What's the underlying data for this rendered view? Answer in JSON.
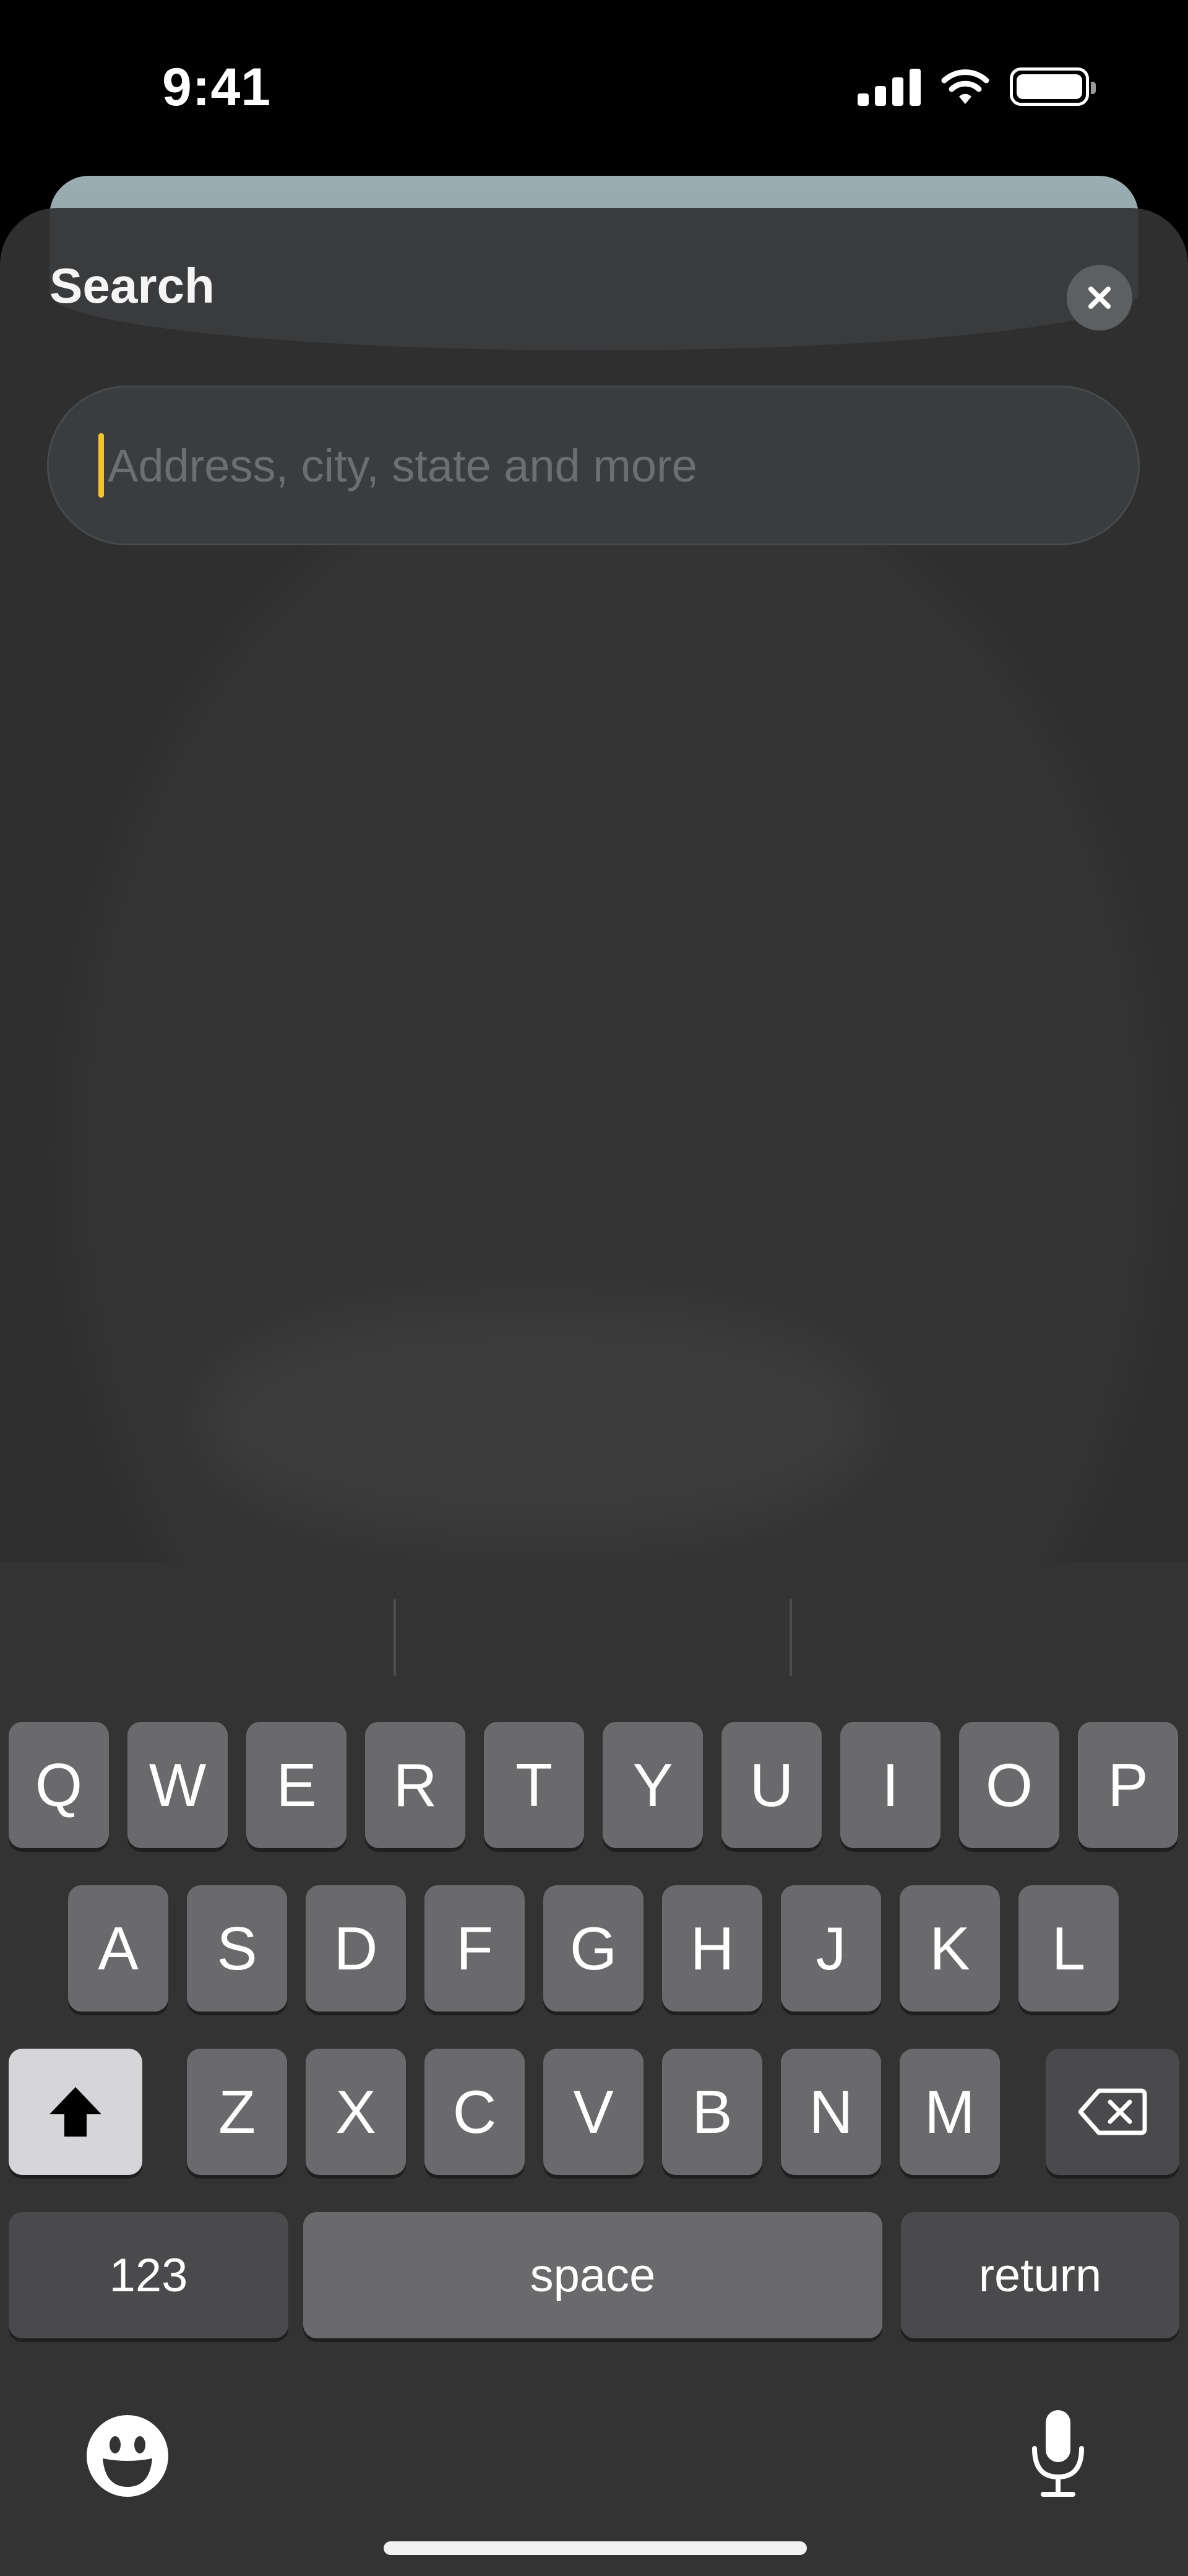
{
  "status_bar": {
    "time": "9:41",
    "icons": [
      "cellular-signal-icon",
      "wifi-icon",
      "battery-icon"
    ]
  },
  "sheet": {
    "title": "Search",
    "close_icon": "close-icon",
    "search": {
      "placeholder": "Address, city, state and more",
      "value": "",
      "caret_color": "#f4c325"
    }
  },
  "keyboard": {
    "row1": [
      "Q",
      "W",
      "E",
      "R",
      "T",
      "Y",
      "U",
      "I",
      "O",
      "P"
    ],
    "row2": [
      "A",
      "S",
      "D",
      "F",
      "G",
      "H",
      "J",
      "K",
      "L"
    ],
    "row3": [
      "Z",
      "X",
      "C",
      "V",
      "B",
      "N",
      "M"
    ],
    "numbers_label": "123",
    "space_label": "space",
    "return_label": "return",
    "shift_icon": "shift-icon",
    "delete_icon": "delete-icon",
    "emoji_icon": "emoji-icon",
    "mic_icon": "microphone-icon"
  }
}
